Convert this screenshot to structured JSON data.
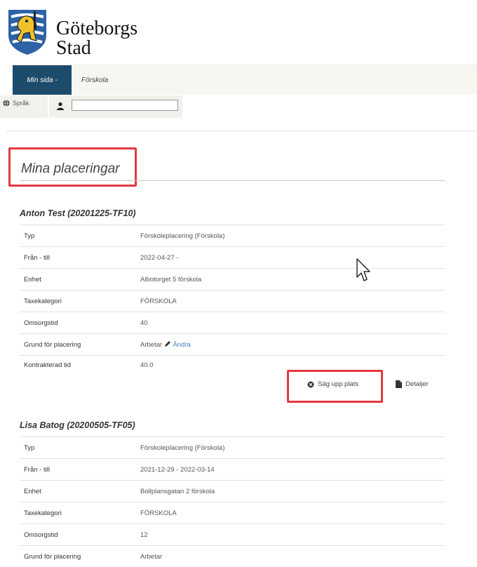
{
  "header": {
    "logo_line1": "Göteborgs",
    "logo_line2": "Stad"
  },
  "nav": {
    "active_label": "Min sida -",
    "item_label": "Förskola"
  },
  "toolbar": {
    "language_label": "Språk",
    "user_value": ""
  },
  "page": {
    "heading": "Mina placeringar"
  },
  "placements": [
    {
      "title": "Anton Test (20201225-TF10)",
      "rows": [
        {
          "label": "Typ",
          "value": "Förskoleplacering (Förskola)"
        },
        {
          "label": "Från - till",
          "value": "2022-04-27 -"
        },
        {
          "label": "Enhet",
          "value": "Albotorget 5 förskola"
        },
        {
          "label": "Taxekategori",
          "value": "FÖRSKOLA"
        },
        {
          "label": "Omsorgstid",
          "value": "40"
        },
        {
          "label": "Grund för placering",
          "value": "Arbetar",
          "edit": "Ändra"
        },
        {
          "label": "Kontrakterad tid",
          "value": "40.0"
        }
      ],
      "actions": {
        "terminate_label": "Säg upp plats",
        "details_label": "Detaljer"
      }
    },
    {
      "title": "Lisa Batog (20200505-TF05)",
      "rows": [
        {
          "label": "Typ",
          "value": "Förskoleplacering (Förskola)"
        },
        {
          "label": "Från - till",
          "value": "2021-12-29 - 2022-03-14"
        },
        {
          "label": "Enhet",
          "value": "Bollplansgatan 2 förskola"
        },
        {
          "label": "Taxekategori",
          "value": "FÖRSKOLA"
        },
        {
          "label": "Omsorgstid",
          "value": "12"
        },
        {
          "label": "Grund för placering",
          "value": "Arbetar"
        }
      ]
    }
  ],
  "colors": {
    "nav_active": "#1d4b6c",
    "highlight": "#e3383f",
    "link": "#3a7fb8"
  },
  "icons": {
    "language": "globe-icon",
    "user": "user-icon",
    "edit": "pencil-icon",
    "terminate": "circle-x-icon",
    "details": "document-icon",
    "cursor": "mouse-pointer"
  }
}
